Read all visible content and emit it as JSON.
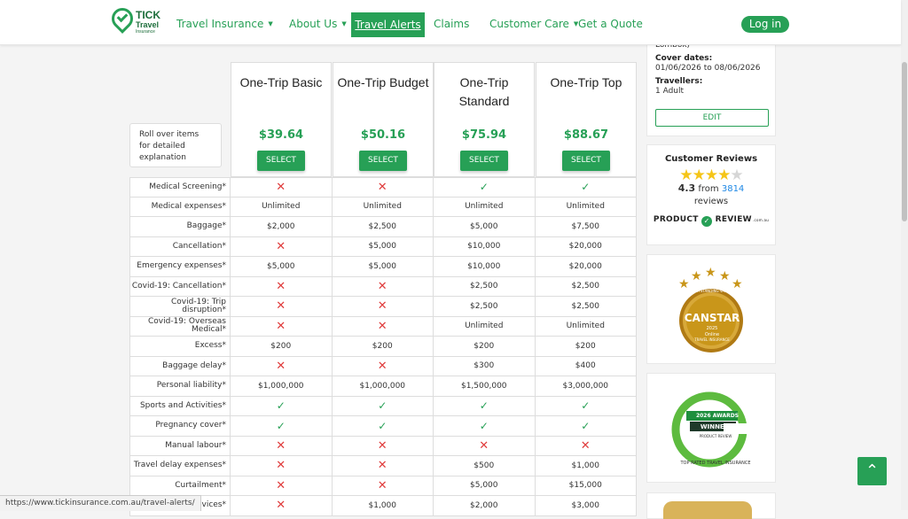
{
  "logo": {
    "line1": "TICK",
    "line2": "Travel",
    "line3": "Insurance"
  },
  "nav": {
    "items": [
      {
        "label": "Travel Insurance",
        "caret": true
      },
      {
        "label": "About Us",
        "caret": true
      },
      {
        "label": "Travel Alerts",
        "caret": false
      },
      {
        "label": "Claims",
        "caret": false
      },
      {
        "label": "Customer Care",
        "caret": true
      },
      {
        "label": "Get a Quote",
        "caret": false
      }
    ],
    "login": "Log in"
  },
  "rollover_text": "Roll over items for detailed explanation",
  "plans": [
    {
      "name": "One-Trip Basic",
      "price": "$39.64",
      "select": "SELECT"
    },
    {
      "name": "One-Trip Budget",
      "price": "$50.16",
      "select": "SELECT"
    },
    {
      "name": "One-Trip Standard",
      "price": "$75.94",
      "select": "SELECT"
    },
    {
      "name": "One-Trip Top",
      "price": "$88.67",
      "select": "SELECT"
    }
  ],
  "rows": [
    {
      "label": "Medical Screening*",
      "values": [
        "x",
        "x",
        "v",
        "v"
      ]
    },
    {
      "label": "Medical expenses*",
      "values": [
        "Unlimited",
        "Unlimited",
        "Unlimited",
        "Unlimited"
      ]
    },
    {
      "label": "Baggage*",
      "values": [
        "$2,000",
        "$2,500",
        "$5,000",
        "$7,500"
      ]
    },
    {
      "label": "Cancellation*",
      "values": [
        "x",
        "$5,000",
        "$10,000",
        "$20,000"
      ]
    },
    {
      "label": "Emergency expenses*",
      "values": [
        "$5,000",
        "$5,000",
        "$10,000",
        "$20,000"
      ]
    },
    {
      "label": "Covid-19: Cancellation*",
      "values": [
        "x",
        "x",
        "$2,500",
        "$2,500"
      ]
    },
    {
      "label": "Covid-19: Trip disruption*",
      "values": [
        "x",
        "x",
        "$2,500",
        "$2,500"
      ]
    },
    {
      "label": "Covid-19: Overseas Medical*",
      "values": [
        "x",
        "x",
        "Unlimited",
        "Unlimited"
      ]
    },
    {
      "label": "Excess*",
      "values": [
        "$200",
        "$200",
        "$200",
        "$200"
      ]
    },
    {
      "label": "Baggage delay*",
      "values": [
        "x",
        "x",
        "$300",
        "$400"
      ]
    },
    {
      "label": "Personal liability*",
      "values": [
        "$1,000,000",
        "$1,000,000",
        "$1,500,000",
        "$3,000,000"
      ]
    },
    {
      "label": "Sports and Activities*",
      "values": [
        "v",
        "v",
        "v",
        "v"
      ]
    },
    {
      "label": "Pregnancy cover*",
      "values": [
        "v",
        "v",
        "v",
        "v"
      ]
    },
    {
      "label": "Manual labour*",
      "values": [
        "x",
        "x",
        "x",
        "x"
      ]
    },
    {
      "label": "Travel delay expenses*",
      "values": [
        "x",
        "x",
        "$500",
        "$1,000"
      ]
    },
    {
      "label": "Curtailment*",
      "values": [
        "x",
        "x",
        "$5,000",
        "$15,000"
      ]
    },
    {
      "label": "Electronic devices*",
      "values": [
        "x",
        "$1,000",
        "$2,000",
        "$3,000"
      ]
    }
  ],
  "summary": {
    "destination_tail": "Lombok)",
    "cover_label": "Cover dates:",
    "cover_value": "01/06/2026 to 08/06/2026",
    "travellers_label": "Travellers:",
    "travellers_value": "1 Adult",
    "edit": "EDIT"
  },
  "reviews": {
    "title": "Customer Reviews",
    "rating": "4.3",
    "from": "from",
    "count": "3814",
    "reviews_word": "reviews",
    "logo_left": "PRODUCT",
    "logo_right": "REVIEW",
    "logo_domain": ".com.au",
    "stars_filled": 4.3
  },
  "canstar": {
    "top": "OUTSTANDING VALUE",
    "name": "CANSTAR",
    "year": "2025",
    "sub1": "Online",
    "sub2": "TRAVEL INSURANCE"
  },
  "award": {
    "year": "2026 AWARDS",
    "winner": "WINNER",
    "ring": "TOP RATED TRAVEL INSURANCE",
    "pr": "PRODUCT REVIEW"
  },
  "status_url": "https://www.tickinsurance.com.au/travel-alerts/",
  "colors": {
    "brand": "#27a056",
    "cross": "#e03b3b",
    "gold": "#c9961a"
  }
}
